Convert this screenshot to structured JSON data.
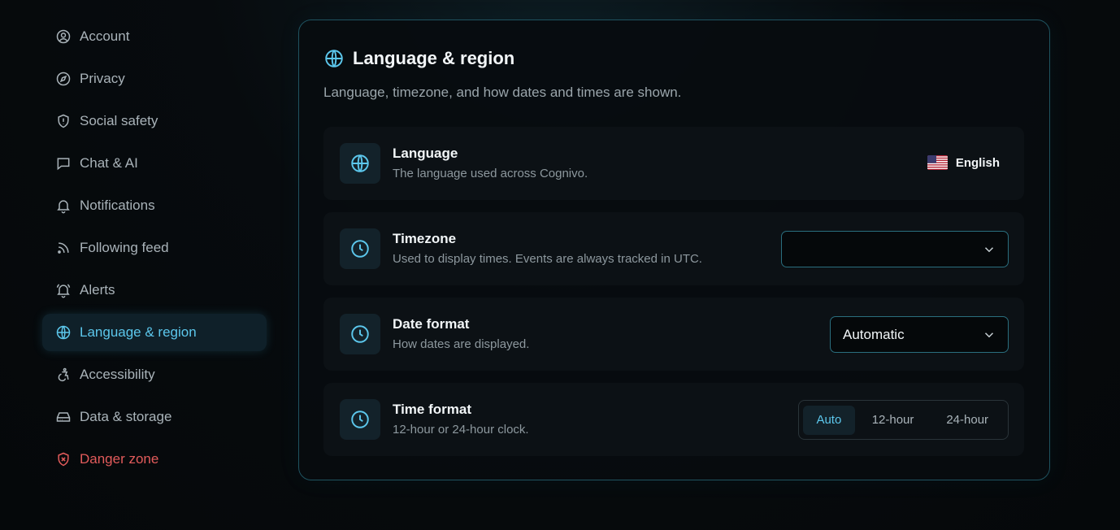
{
  "sidebar": {
    "items": [
      {
        "label": "Account",
        "icon": "user-circle-icon"
      },
      {
        "label": "Privacy",
        "icon": "compass-icon"
      },
      {
        "label": "Social safety",
        "icon": "shield-icon"
      },
      {
        "label": "Chat & AI",
        "icon": "chat-bubble-icon"
      },
      {
        "label": "Notifications",
        "icon": "bell-icon"
      },
      {
        "label": "Following feed",
        "icon": "rss-icon"
      },
      {
        "label": "Alerts",
        "icon": "bell-ring-icon"
      },
      {
        "label": "Language & region",
        "icon": "globe-icon",
        "active": true
      },
      {
        "label": "Accessibility",
        "icon": "accessibility-icon"
      },
      {
        "label": "Data & storage",
        "icon": "hard-drive-icon"
      },
      {
        "label": "Danger zone",
        "icon": "shield-x-icon",
        "danger": true
      }
    ]
  },
  "panel": {
    "title": "Language & region",
    "description": "Language, timezone, and how dates and times are shown."
  },
  "settings": {
    "language": {
      "label": "Language",
      "description": "The language used across Cognivo.",
      "value": "English",
      "flag": "us-flag-icon"
    },
    "timezone": {
      "label": "Timezone",
      "description": "Used to display times. Events are always tracked in UTC.",
      "value": ""
    },
    "date_format": {
      "label": "Date format",
      "description": "How dates are displayed.",
      "value": "Automatic"
    },
    "time_format": {
      "label": "Time format",
      "description": "12-hour or 24-hour clock.",
      "options": [
        "Auto",
        "12-hour",
        "24-hour"
      ],
      "selected": "Auto"
    }
  },
  "colors": {
    "accent": "#5cc7ec",
    "danger": "#e25b5b",
    "border": "#1f5360"
  }
}
